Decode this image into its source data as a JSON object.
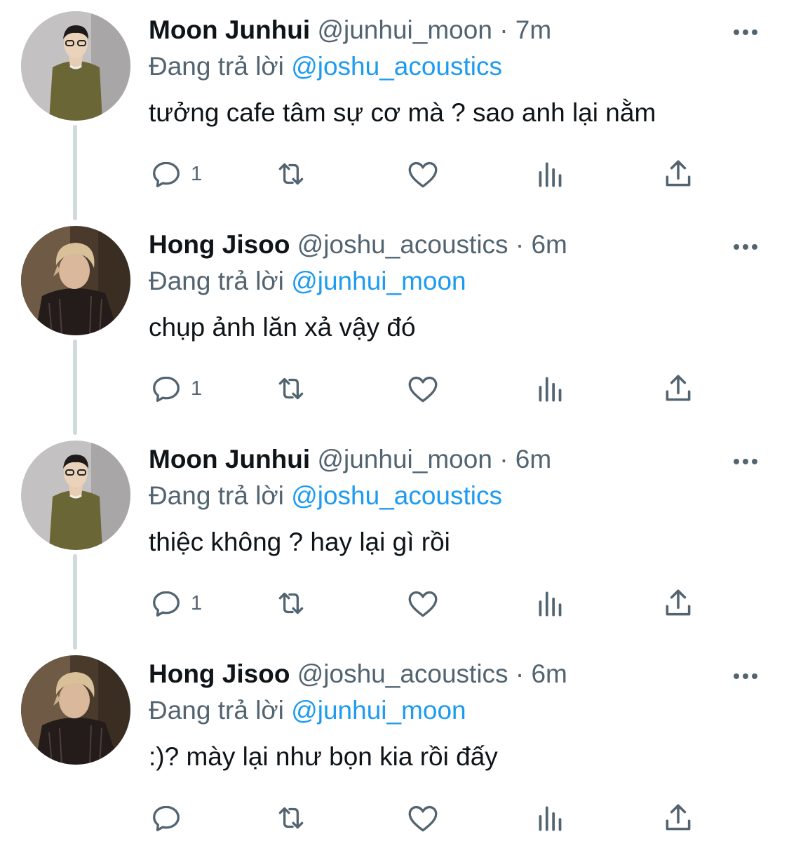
{
  "thread": {
    "replying_prefix": "Đang trả lời",
    "tweets": [
      {
        "name": "Moon Junhui",
        "handle": "@junhui_moon",
        "separator": "·",
        "time": "7m",
        "replying_to": "@joshu_acoustics",
        "text": "tưởng cafe tâm sự cơ mà ? sao anh lại nằm",
        "reply_count": "1",
        "avatar": "avatar-junhui"
      },
      {
        "name": "Hong Jisoo",
        "handle": "@joshu_acoustics",
        "separator": "·",
        "time": "6m",
        "replying_to": "@junhui_moon",
        "text": "chụp ảnh lăn xả vậy đó",
        "reply_count": "1",
        "avatar": "avatar-jisoo"
      },
      {
        "name": "Moon Junhui",
        "handle": "@junhui_moon",
        "separator": "·",
        "time": "6m",
        "replying_to": "@joshu_acoustics",
        "text": "thiệc không ? hay lại gì rồi",
        "reply_count": "1",
        "avatar": "avatar-junhui"
      },
      {
        "name": "Hong Jisoo",
        "handle": "@joshu_acoustics",
        "separator": "·",
        "time": "6m",
        "replying_to": "@junhui_moon",
        "text": ":)? mày lại như bọn kia rồi đấy",
        "reply_count": "",
        "avatar": "avatar-jisoo"
      }
    ]
  },
  "icons": {
    "reply": "reply-icon",
    "retweet": "retweet-icon",
    "like": "like-icon",
    "views": "views-icon",
    "share": "share-icon",
    "more": "more-icon"
  },
  "colors": {
    "mention": "#1d9bf0",
    "secondary_text": "#536471",
    "primary_text": "#0f1419",
    "thread_line": "#cfd9de"
  }
}
